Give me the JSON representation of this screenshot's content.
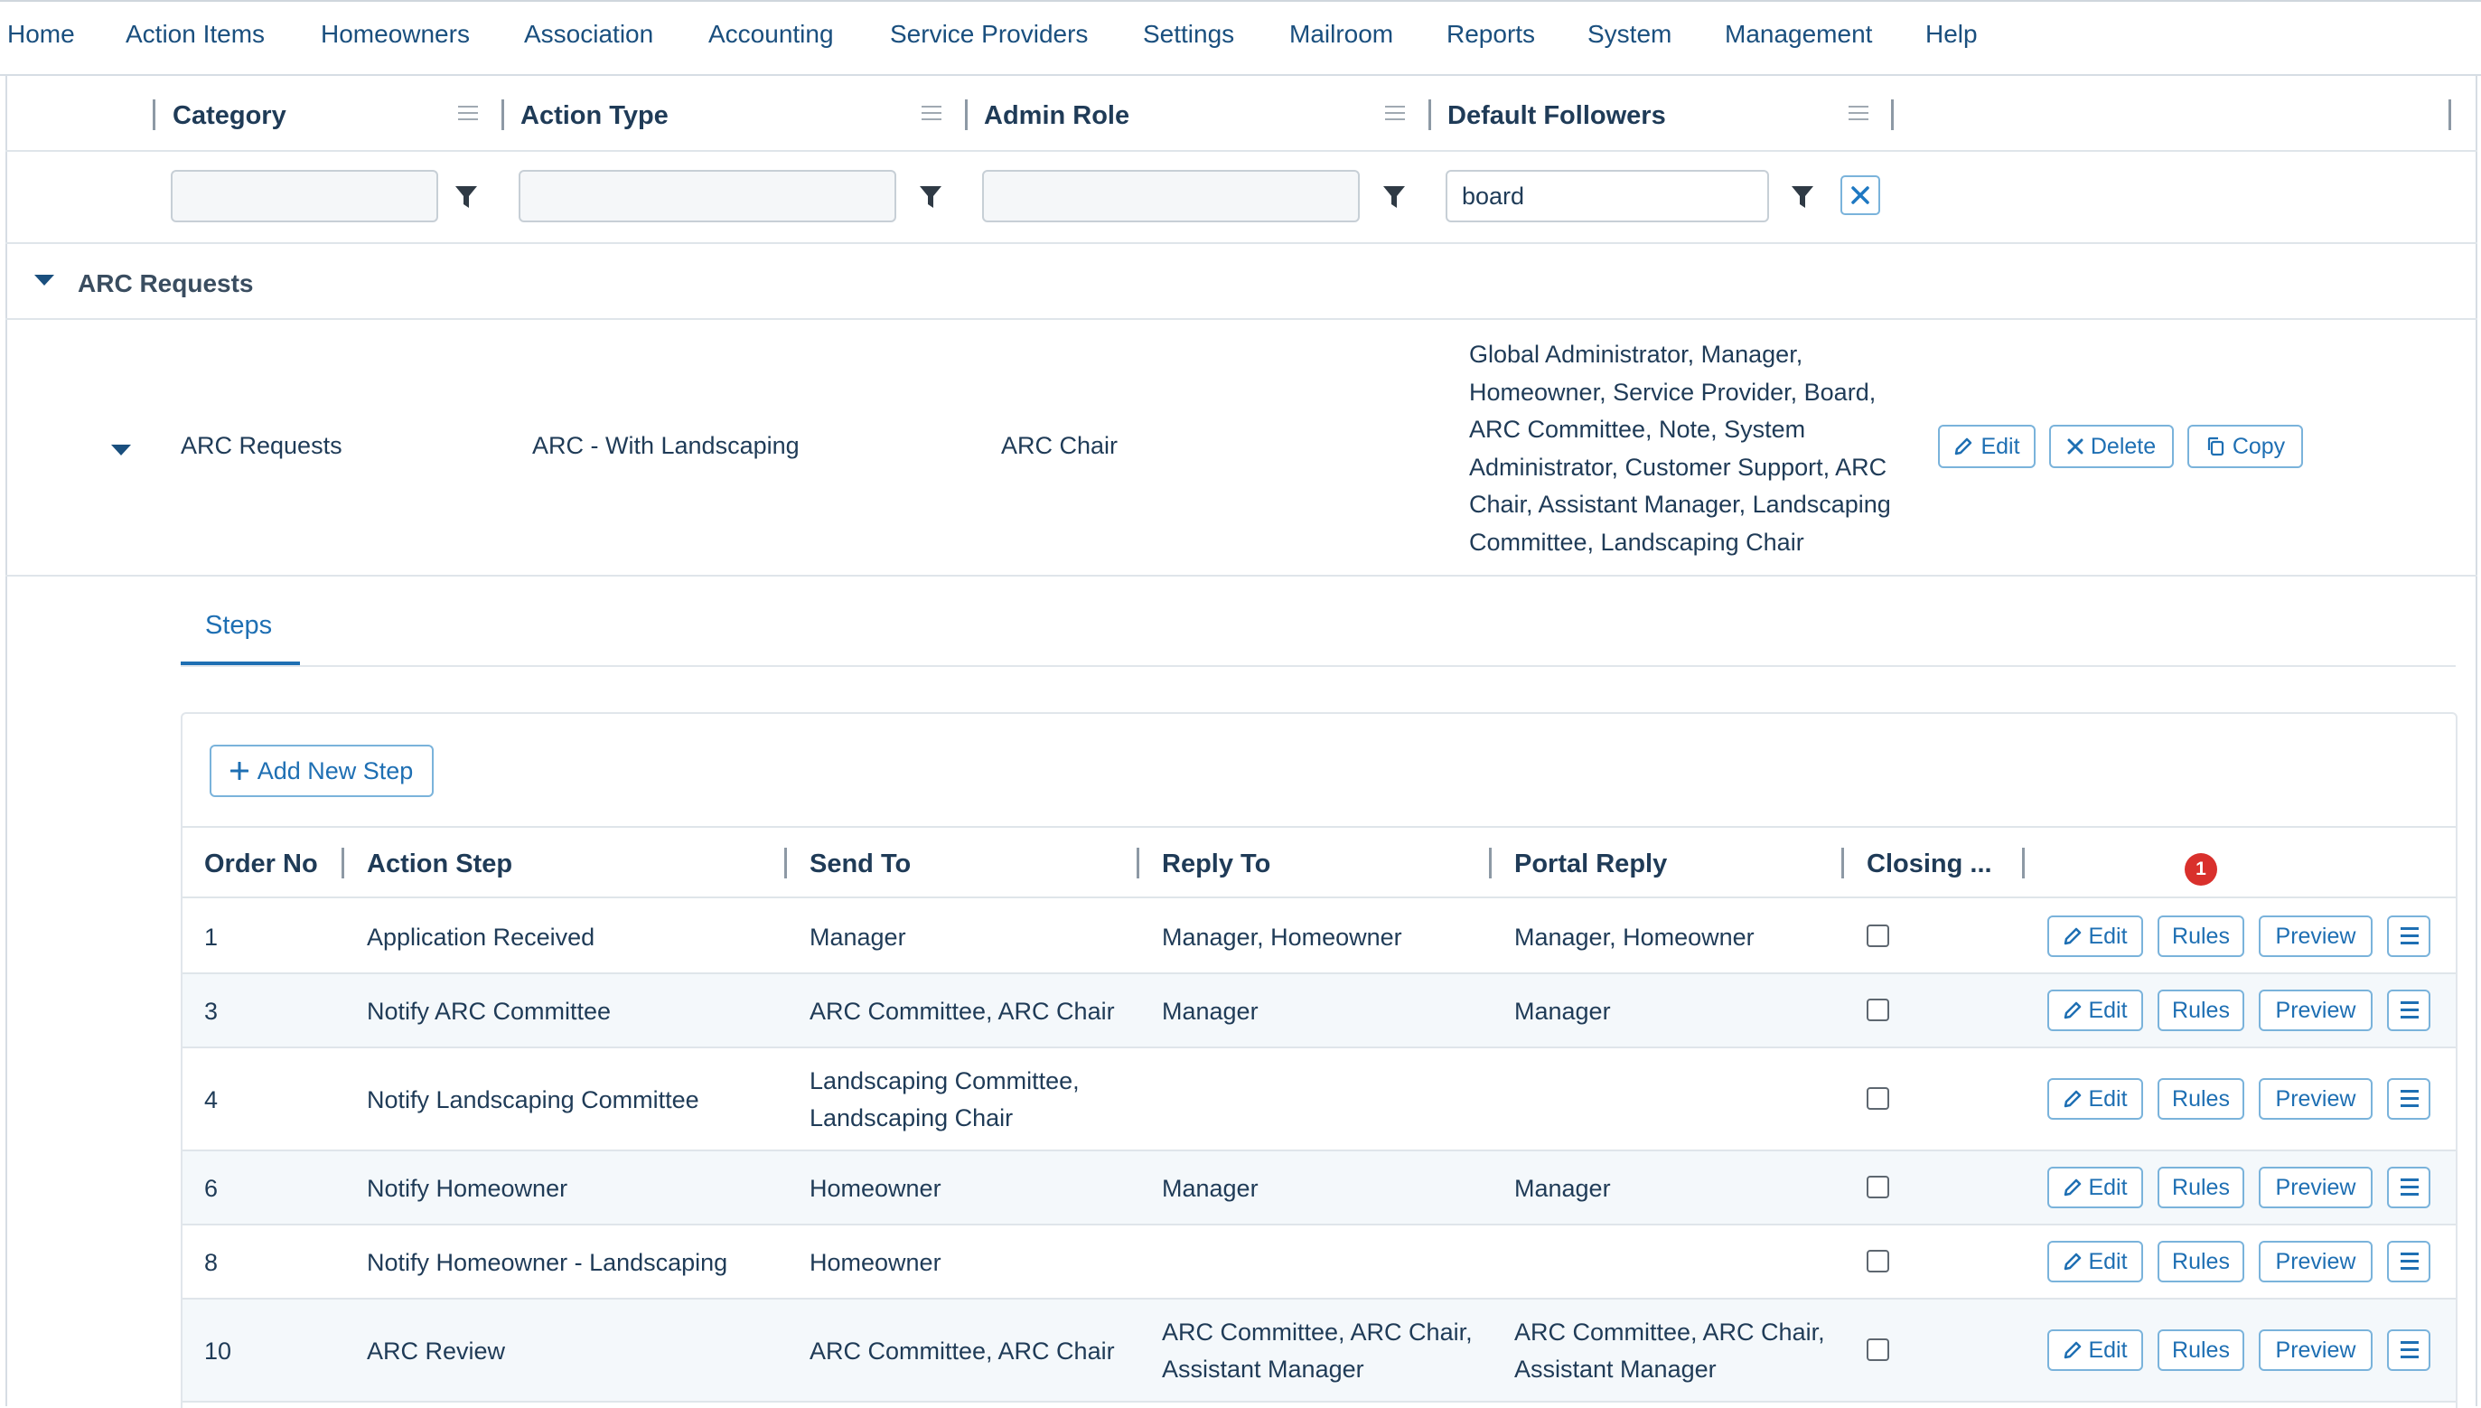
{
  "nav": [
    "Home",
    "Action Items",
    "Homeowners",
    "Association",
    "Accounting",
    "Service Providers",
    "Settings",
    "Mailroom",
    "Reports",
    "System",
    "Management",
    "Help"
  ],
  "grid": {
    "columns": [
      "Category",
      "Action Type",
      "Admin Role",
      "Default Followers"
    ],
    "filters": {
      "category": "",
      "action_type": "",
      "admin_role": "",
      "default_followers": "board"
    }
  },
  "group": {
    "label": "ARC Requests"
  },
  "detail": {
    "category": "ARC Requests",
    "action_type": "ARC - With Landscaping",
    "admin_role": "ARC Chair",
    "followers_lines": [
      "Global Administrator, Manager,",
      "Homeowner, Service Provider, Board,",
      "ARC Committee, Note, System",
      "Administrator, Customer Support, ARC",
      "Chair, Assistant Manager, Landscaping",
      "Committee, Landscaping Chair"
    ],
    "buttons": {
      "edit": "Edit",
      "delete": "Delete",
      "copy": "Copy"
    }
  },
  "tabs": {
    "steps": "Steps"
  },
  "steps": {
    "add_label": "Add New Step",
    "columns": [
      "Order No",
      "Action Step",
      "Send To",
      "Reply To",
      "Portal Reply",
      "Closing ..."
    ],
    "badge": "1",
    "buttons": {
      "edit": "Edit",
      "rules": "Rules",
      "preview": "Preview"
    },
    "rows": [
      {
        "order": "1",
        "step": "Application Received",
        "send_to": [
          "Manager"
        ],
        "reply_to": [
          "Manager, Homeowner"
        ],
        "portal_reply": [
          "Manager, Homeowner"
        ],
        "closing": false
      },
      {
        "order": "3",
        "step": "Notify ARC Committee",
        "send_to": [
          "ARC Committee, ARC Chair"
        ],
        "reply_to": [
          "Manager"
        ],
        "portal_reply": [
          "Manager"
        ],
        "closing": false
      },
      {
        "order": "4",
        "step": "Notify Landscaping Committee",
        "send_to": [
          "Landscaping Committee,",
          "Landscaping Chair"
        ],
        "reply_to": [],
        "portal_reply": [],
        "closing": false
      },
      {
        "order": "6",
        "step": "Notify Homeowner",
        "send_to": [
          "Homeowner"
        ],
        "reply_to": [
          "Manager"
        ],
        "portal_reply": [
          "Manager"
        ],
        "closing": false
      },
      {
        "order": "8",
        "step": "Notify Homeowner - Landscaping",
        "send_to": [
          "Homeowner"
        ],
        "reply_to": [],
        "portal_reply": [],
        "closing": false
      },
      {
        "order": "10",
        "step": "ARC Review",
        "send_to": [
          "ARC Committee, ARC Chair"
        ],
        "reply_to": [
          "ARC Committee, ARC Chair,",
          "Assistant Manager"
        ],
        "portal_reply": [
          "ARC Committee, ARC Chair,",
          "Assistant Manager"
        ],
        "closing": false
      }
    ]
  },
  "colors": {
    "accent": "#1e6fb3",
    "badge": "#d9302c",
    "text": "#1f3b57"
  }
}
